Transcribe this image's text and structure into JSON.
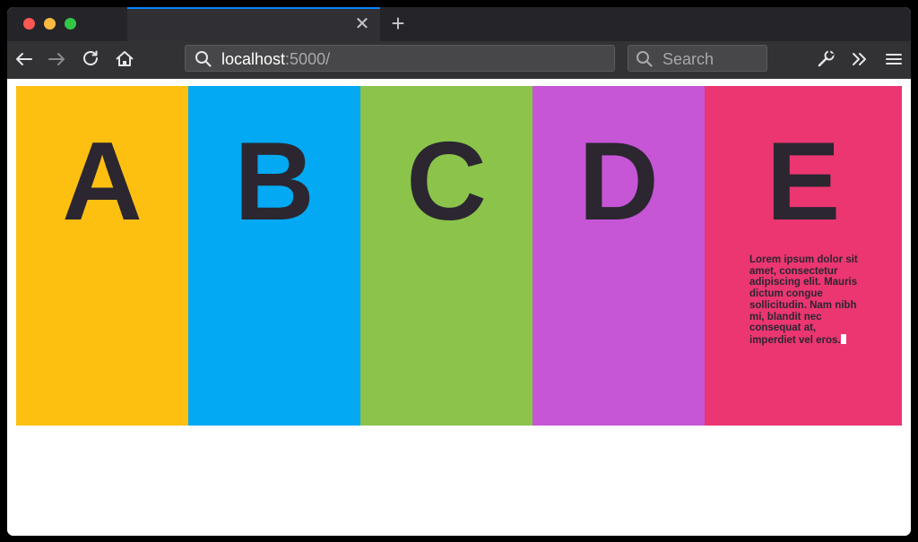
{
  "browser": {
    "url_host": "localhost",
    "url_path": ":5000/",
    "search_placeholder": "Search",
    "tab_close_glyph": "✕",
    "new_tab_glyph": "+",
    "icons": [
      "back-arrow-icon",
      "forward-arrow-icon",
      "reload-icon",
      "home-icon",
      "search-icon",
      "wrench-icon",
      "overflow-chevron-icon",
      "menu-icon"
    ]
  },
  "panels": [
    {
      "letter": "A",
      "color": "#fdc010",
      "text": ""
    },
    {
      "letter": "B",
      "color": "#03a9f3",
      "text": ""
    },
    {
      "letter": "C",
      "color": "#8bc34b",
      "text": ""
    },
    {
      "letter": "D",
      "color": "#c656d6",
      "text": ""
    },
    {
      "letter": "E",
      "color": "#eb3671",
      "text": "Lorem ipsum dolor sit amet, consectetur adipiscing elit. Mauris dictum congue sollicitudin. Nam nibh mi, blandit nec consequat at, imperdiet vel eros."
    }
  ]
}
